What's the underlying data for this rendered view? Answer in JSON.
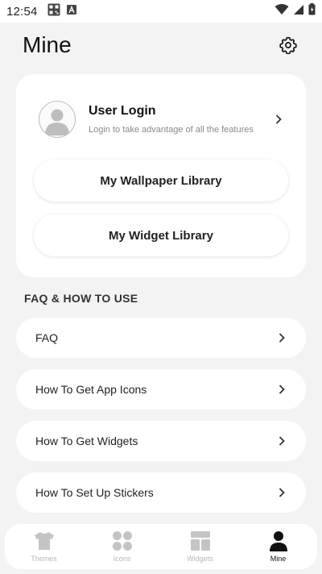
{
  "status_bar": {
    "time": "12:54",
    "left_icons": [
      "qr-code-icon",
      "a-icon"
    ],
    "right_icons": [
      "wifi-icon",
      "signal-icon",
      "battery-icon"
    ]
  },
  "header": {
    "title": "Mine",
    "settings_icon": "gear-icon"
  },
  "profile": {
    "login_title": "User Login",
    "login_subtitle": "Login to take advantage of all the features",
    "avatar_icon": "user-avatar-icon"
  },
  "library": {
    "wallpaper_label": "My Wallpaper Library",
    "widget_label": "My Widget Library"
  },
  "faq_section": {
    "title": "FAQ & HOW TO USE",
    "items": [
      {
        "label": "FAQ"
      },
      {
        "label": "How To Get App Icons"
      },
      {
        "label": "How To Get Widgets"
      },
      {
        "label": "How To Set Up Stickers"
      }
    ]
  },
  "bottom_nav": {
    "items": [
      {
        "label": "Themes",
        "icon": "tshirt-icon",
        "active": false
      },
      {
        "label": "Icons",
        "icon": "grid-circles-icon",
        "active": false
      },
      {
        "label": "Widgets",
        "icon": "widgets-icon",
        "active": false
      },
      {
        "label": "Mine",
        "icon": "person-icon",
        "active": true
      }
    ]
  },
  "colors": {
    "background": "#f3f3f3",
    "card": "#ffffff",
    "inactive_nav": "#c4c4c4",
    "active_nav": "#111111"
  }
}
